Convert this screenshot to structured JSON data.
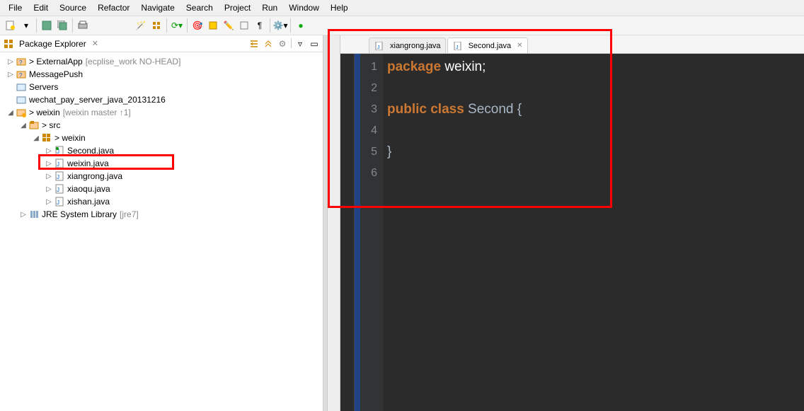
{
  "menus": [
    "File",
    "Edit",
    "Source",
    "Refactor",
    "Navigate",
    "Search",
    "Project",
    "Run",
    "Window",
    "Help"
  ],
  "explorer": {
    "title": "Package Explorer",
    "items": [
      {
        "label": "> ExternalApp",
        "suffix": "[ecplise_work NO-HEAD]"
      },
      {
        "label": "MessagePush"
      },
      {
        "label": "Servers"
      },
      {
        "label": "wechat_pay_server_java_20131216"
      },
      {
        "label": "> weixin",
        "suffix": "[weixin master ↑1]"
      },
      {
        "label": "> src"
      },
      {
        "label": "> weixin"
      },
      {
        "label": "Second.java"
      },
      {
        "label": "weixin.java"
      },
      {
        "label": "xiangrong.java"
      },
      {
        "label": "xiaoqu.java"
      },
      {
        "label": "xishan.java"
      },
      {
        "label": "JRE System Library",
        "suffix": "[jre7]"
      }
    ]
  },
  "tabs": [
    {
      "label": "xiangrong.java"
    },
    {
      "label": "Second.java"
    }
  ],
  "code": {
    "lines": [
      "1",
      "2",
      "3",
      "4",
      "5",
      "6"
    ],
    "l1_kw": "package",
    "l1_ident": " weixin;",
    "l3_kw1": "public",
    "l3_kw2": " class",
    "l3_name": " Second ",
    "l3_brace": "{",
    "l5_brace": "}"
  }
}
